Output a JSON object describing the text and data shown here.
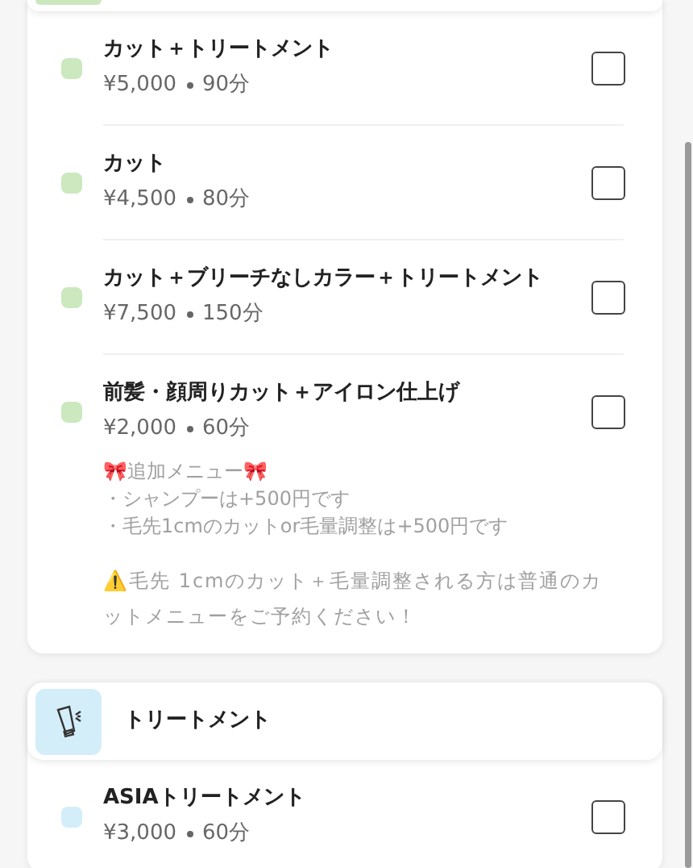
{
  "sections": [
    {
      "color": "#cbe8bf",
      "items": [
        {
          "name": "カット＋トリートメント",
          "price": "¥5,000",
          "duration": "90分",
          "checked": false
        },
        {
          "name": "カット",
          "price": "¥4,500",
          "duration": "80分",
          "checked": false
        },
        {
          "name": "カット＋ブリーチなしカラー＋トリートメント",
          "price": "¥7,500",
          "duration": "150分",
          "checked": false
        },
        {
          "name": "前髪・顔周りカット＋アイロン仕上げ",
          "price": "¥2,000",
          "duration": "60分",
          "checked": false,
          "notes": [
            "🎀追加メニュー🎀",
            "・シャンプーは+500円です",
            "・毛先1cmのカットor毛量調整は+500円です"
          ],
          "warning": "⚠️毛先 1cmのカット＋毛量調整される方は普通のカットメニューをご予約ください！"
        }
      ]
    },
    {
      "title": "トリートメント",
      "color": "#d3eef9",
      "items": [
        {
          "name": "ASIAトリートメント",
          "price": "¥3,000",
          "duration": "60分",
          "checked": false
        }
      ]
    }
  ]
}
